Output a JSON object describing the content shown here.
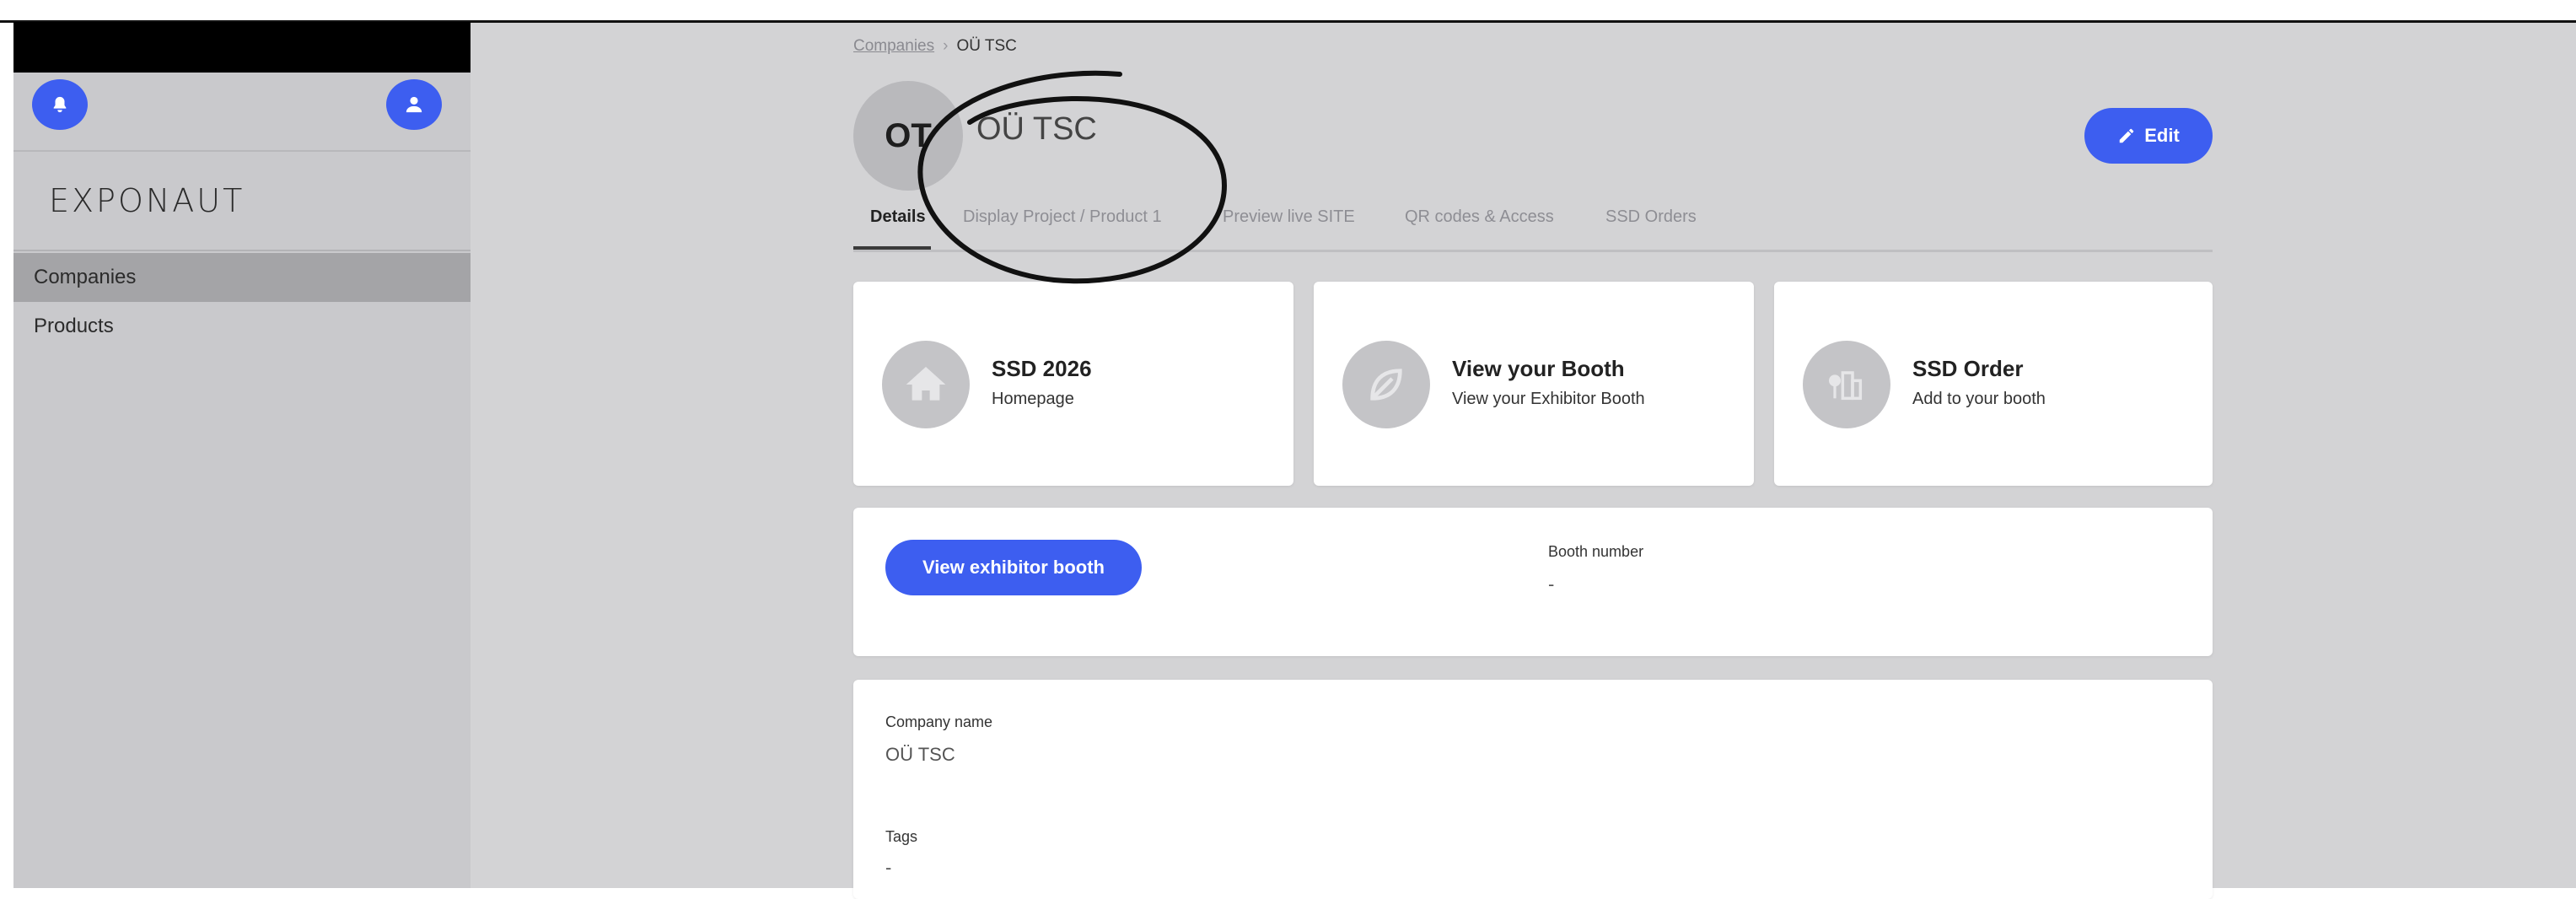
{
  "sidebar": {
    "logo_text": "EXPONAUT",
    "notification_icon": "bell-icon",
    "profile_icon": "user-icon",
    "items": [
      {
        "label": "Companies",
        "active": true
      },
      {
        "label": "Products",
        "active": false
      }
    ]
  },
  "breadcrumb": {
    "link": "Companies",
    "separator": "›",
    "current": "OÜ TSC"
  },
  "company": {
    "initials": "OT",
    "name": "OÜ TSC"
  },
  "edit_button": {
    "label": "Edit",
    "icon": "pencil-icon"
  },
  "tabs": [
    {
      "label": "Details",
      "active": true
    },
    {
      "label": "Display Project / Product 1",
      "active": false
    },
    {
      "label": "Preview live SITE",
      "active": false
    },
    {
      "label": "QR codes & Access",
      "active": false
    },
    {
      "label": "SSD Orders",
      "active": false
    }
  ],
  "cards": [
    {
      "title": "SSD 2026",
      "subtitle": "Homepage",
      "icon": "home-icon"
    },
    {
      "title": "View your Booth",
      "subtitle": "View your Exhibitor Booth",
      "icon": "leaf-icon"
    },
    {
      "title": "SSD Order",
      "subtitle": "Add to your booth",
      "icon": "buildings-icon"
    }
  ],
  "booth": {
    "button_label": "View exhibitor booth",
    "number_label": "Booth number",
    "number_value": "-"
  },
  "details": {
    "company_name_label": "Company name",
    "company_name_value": "OÜ TSC",
    "tags_label": "Tags",
    "tags_value": "-"
  },
  "colors": {
    "accent": "#3d5ef0",
    "sidebar_bg": "#c9c9cc",
    "main_bg": "#d3d3d5"
  }
}
